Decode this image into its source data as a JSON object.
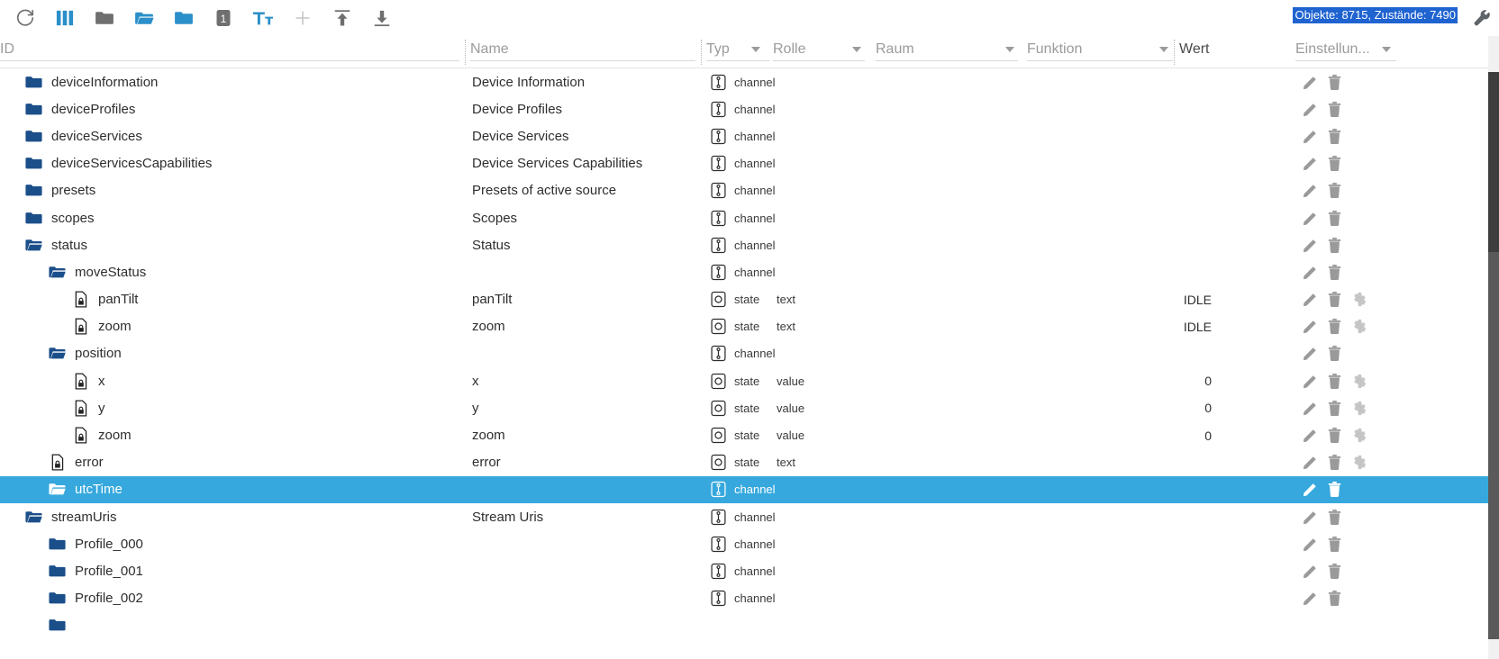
{
  "toolbar": {
    "buttons": [
      {
        "name": "refresh-icon",
        "label": "Refresh",
        "color": "#6f6f6f"
      },
      {
        "name": "columns-icon",
        "label": "Columns",
        "color": "#2b8fc9"
      },
      {
        "name": "folder-closed-icon",
        "label": "Collapse all",
        "color": "#6f6f6f"
      },
      {
        "name": "folder-open-icon",
        "label": "Expand all",
        "color": "#2b8fc9"
      },
      {
        "name": "folder-icon",
        "label": "Folder",
        "color": "#2b8fc9"
      },
      {
        "name": "expand-level-1-icon",
        "label": "1",
        "color": "#6f6f6f"
      },
      {
        "name": "text-size-icon",
        "label": "Tt",
        "color": "#2b8fc9"
      },
      {
        "name": "add-icon",
        "label": "Add object",
        "color": "#c4c4c4"
      },
      {
        "name": "upload-icon",
        "label": "Import",
        "color": "#6f6f6f"
      },
      {
        "name": "download-icon",
        "label": "Export",
        "color": "#6f6f6f"
      }
    ],
    "status": "Objekte: 8715, Zustände: 7490",
    "status_bg": "#1f63d0",
    "settings_icon": "wrench-icon"
  },
  "columns": {
    "id": "ID",
    "name": "Name",
    "typ": "Typ",
    "rolle": "Rolle",
    "raum": "Raum",
    "funktion": "Funktion",
    "wert": "Wert",
    "einstellungen": "Einstellun..."
  },
  "rows": [
    {
      "indent": 1,
      "icon": "folder-closed-icon",
      "id": "deviceInformation",
      "name": "Device Information",
      "typ": "channel",
      "type_icon": "channel-icon",
      "rolle": "",
      "wert": "",
      "actions": [
        "edit-icon",
        "delete-icon"
      ],
      "selected": false
    },
    {
      "indent": 1,
      "icon": "folder-closed-icon",
      "id": "deviceProfiles",
      "name": "Device Profiles",
      "typ": "channel",
      "type_icon": "channel-icon",
      "rolle": "",
      "wert": "",
      "actions": [
        "edit-icon",
        "delete-icon"
      ],
      "selected": false
    },
    {
      "indent": 1,
      "icon": "folder-closed-icon",
      "id": "deviceServices",
      "name": "Device Services",
      "typ": "channel",
      "type_icon": "channel-icon",
      "rolle": "",
      "wert": "",
      "actions": [
        "edit-icon",
        "delete-icon"
      ],
      "selected": false
    },
    {
      "indent": 1,
      "icon": "folder-closed-icon",
      "id": "deviceServicesCapabilities",
      "name": "Device Services Capabilities",
      "typ": "channel",
      "type_icon": "channel-icon",
      "rolle": "",
      "wert": "",
      "actions": [
        "edit-icon",
        "delete-icon"
      ],
      "selected": false
    },
    {
      "indent": 1,
      "icon": "folder-closed-icon",
      "id": "presets",
      "name": "Presets of active source",
      "typ": "channel",
      "type_icon": "channel-icon",
      "rolle": "",
      "wert": "",
      "actions": [
        "edit-icon",
        "delete-icon"
      ],
      "selected": false
    },
    {
      "indent": 1,
      "icon": "folder-closed-icon",
      "id": "scopes",
      "name": "Scopes",
      "typ": "channel",
      "type_icon": "channel-icon",
      "rolle": "",
      "wert": "",
      "actions": [
        "edit-icon",
        "delete-icon"
      ],
      "selected": false
    },
    {
      "indent": 1,
      "icon": "folder-open-icon",
      "id": "status",
      "name": "Status",
      "typ": "channel",
      "type_icon": "channel-icon",
      "rolle": "",
      "wert": "",
      "actions": [
        "edit-icon",
        "delete-icon"
      ],
      "selected": false
    },
    {
      "indent": 2,
      "icon": "folder-open-icon",
      "id": "moveStatus",
      "name": "",
      "typ": "channel",
      "type_icon": "channel-icon",
      "rolle": "",
      "wert": "",
      "actions": [
        "edit-icon",
        "delete-icon"
      ],
      "selected": false
    },
    {
      "indent": 3,
      "icon": "state-file-icon",
      "id": "panTilt",
      "name": "panTilt",
      "typ": "state",
      "type_icon": "state-icon",
      "rolle": "text",
      "wert": "IDLE",
      "actions": [
        "edit-icon",
        "delete-icon",
        "settings-icon"
      ],
      "selected": false
    },
    {
      "indent": 3,
      "icon": "state-file-icon",
      "id": "zoom",
      "name": "zoom",
      "typ": "state",
      "type_icon": "state-icon",
      "rolle": "text",
      "wert": "IDLE",
      "actions": [
        "edit-icon",
        "delete-icon",
        "settings-icon"
      ],
      "selected": false
    },
    {
      "indent": 2,
      "icon": "folder-open-icon",
      "id": "position",
      "name": "",
      "typ": "channel",
      "type_icon": "channel-icon",
      "rolle": "",
      "wert": "",
      "actions": [
        "edit-icon",
        "delete-icon"
      ],
      "selected": false
    },
    {
      "indent": 3,
      "icon": "state-file-icon",
      "id": "x",
      "name": "x",
      "typ": "state",
      "type_icon": "state-icon",
      "rolle": "value",
      "wert": "0",
      "actions": [
        "edit-icon",
        "delete-icon",
        "settings-icon"
      ],
      "selected": false
    },
    {
      "indent": 3,
      "icon": "state-file-icon",
      "id": "y",
      "name": "y",
      "typ": "state",
      "type_icon": "state-icon",
      "rolle": "value",
      "wert": "0",
      "actions": [
        "edit-icon",
        "delete-icon",
        "settings-icon"
      ],
      "selected": false
    },
    {
      "indent": 3,
      "icon": "state-file-icon",
      "id": "zoom",
      "name": "zoom",
      "typ": "state",
      "type_icon": "state-icon",
      "rolle": "value",
      "wert": "0",
      "actions": [
        "edit-icon",
        "delete-icon",
        "settings-icon"
      ],
      "selected": false
    },
    {
      "indent": 2,
      "icon": "state-file-icon",
      "id": "error",
      "name": "error",
      "typ": "state",
      "type_icon": "state-icon",
      "rolle": "text",
      "wert": "",
      "actions": [
        "edit-icon",
        "delete-icon",
        "settings-icon"
      ],
      "selected": false
    },
    {
      "indent": 2,
      "icon": "folder-open-icon",
      "id": "utcTime",
      "name": "",
      "typ": "channel",
      "type_icon": "channel-icon",
      "rolle": "",
      "wert": "",
      "actions": [
        "edit-icon",
        "delete-icon"
      ],
      "selected": true
    },
    {
      "indent": 1,
      "icon": "folder-open-icon",
      "id": "streamUris",
      "name": "Stream Uris",
      "typ": "channel",
      "type_icon": "channel-icon",
      "rolle": "",
      "wert": "",
      "actions": [
        "edit-icon",
        "delete-icon"
      ],
      "selected": false
    },
    {
      "indent": 2,
      "icon": "folder-closed-icon",
      "id": "Profile_000",
      "name": "",
      "typ": "channel",
      "type_icon": "channel-icon",
      "rolle": "",
      "wert": "",
      "actions": [
        "edit-icon",
        "delete-icon"
      ],
      "selected": false
    },
    {
      "indent": 2,
      "icon": "folder-closed-icon",
      "id": "Profile_001",
      "name": "",
      "typ": "channel",
      "type_icon": "channel-icon",
      "rolle": "",
      "wert": "",
      "actions": [
        "edit-icon",
        "delete-icon"
      ],
      "selected": false
    },
    {
      "indent": 2,
      "icon": "folder-closed-icon",
      "id": "Profile_002",
      "name": "",
      "typ": "channel",
      "type_icon": "channel-icon",
      "rolle": "",
      "wert": "",
      "actions": [
        "edit-icon",
        "delete-icon"
      ],
      "selected": false
    },
    {
      "indent": 2,
      "icon": "folder-closed-icon",
      "id": "",
      "name": "",
      "typ": "",
      "type_icon": "",
      "rolle": "",
      "wert": "",
      "actions": [],
      "selected": false
    }
  ]
}
